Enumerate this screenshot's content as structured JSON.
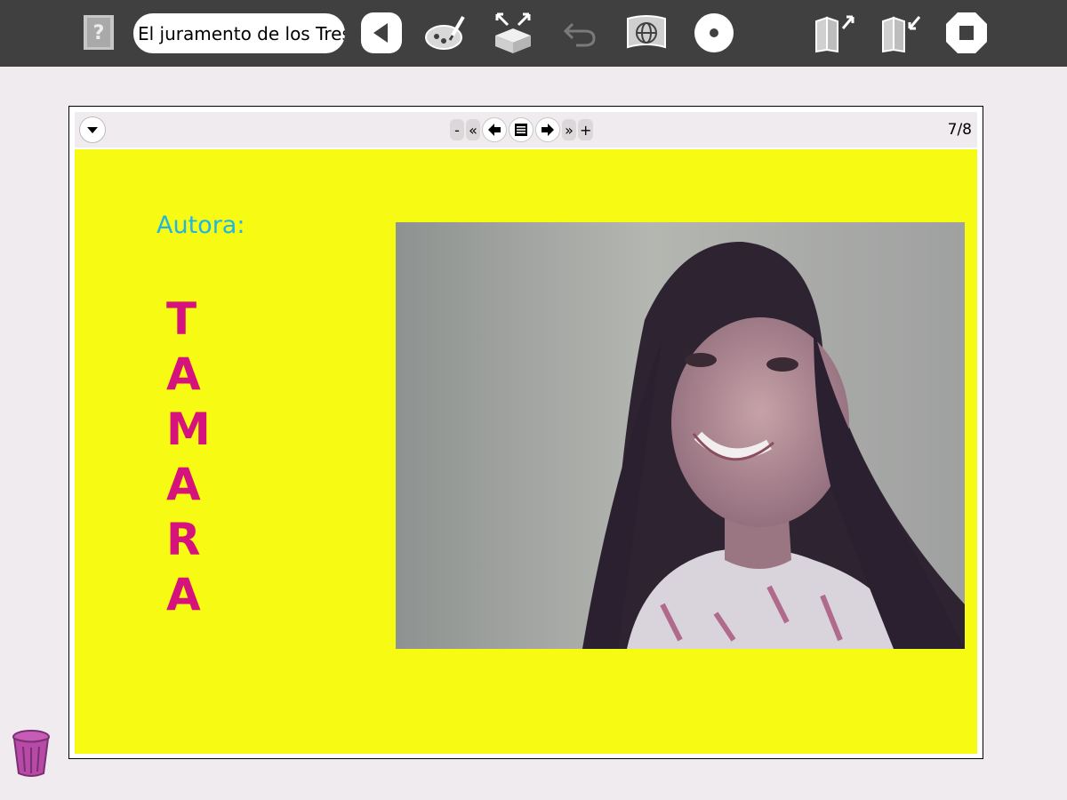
{
  "toolbar": {
    "title_value": "El juramento de los Tres",
    "icons": [
      "help-icon",
      "back-icon",
      "paint-icon",
      "export-box-icon",
      "undo-icon",
      "share-globe-icon",
      "record-icon",
      "fullscreen-icon",
      "unfullscreen-icon",
      "stop-icon"
    ]
  },
  "document": {
    "nav": {
      "minus_label": "-",
      "first_label": "«",
      "last_label": "»",
      "plus_label": "+",
      "page_count": "7/8"
    },
    "slide": {
      "heading": "Autora:",
      "name_letters": [
        "T",
        "A",
        "M",
        "A",
        "R",
        "A"
      ],
      "background_color": "#f7fa12",
      "heading_color": "#1fb6e4",
      "name_color": "#d6127c"
    }
  },
  "colors": {
    "toolbar": "#404040",
    "desktop": "#efebee"
  }
}
